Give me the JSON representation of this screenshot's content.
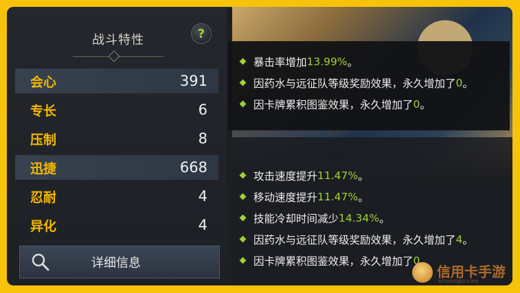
{
  "panel": {
    "title": "战斗特性",
    "help_icon": "?",
    "stats": [
      {
        "name": "会心",
        "value": "391",
        "highlight": true
      },
      {
        "name": "专长",
        "value": "6",
        "highlight": false
      },
      {
        "name": "压制",
        "value": "8",
        "highlight": false
      },
      {
        "name": "迅捷",
        "value": "668",
        "highlight": true
      },
      {
        "name": "忍耐",
        "value": "4",
        "highlight": false
      },
      {
        "name": "异化",
        "value": "4",
        "highlight": false
      }
    ],
    "detail_button": "详细信息"
  },
  "tooltip1": {
    "lines": [
      {
        "text": "暴击率增加",
        "value": "13.99%",
        "suffix": "。"
      },
      {
        "text": "因药水与远征队等级奖励效果，永久增加了",
        "value": "0",
        "suffix": "。"
      },
      {
        "text": "因卡牌累积图鉴效果，永久增加了",
        "value": "0",
        "suffix": "。"
      }
    ]
  },
  "tooltip2": {
    "lines": [
      {
        "text": "攻击速度提升",
        "value": "11.47%",
        "suffix": "。"
      },
      {
        "text": "移动速度提升",
        "value": "11.47%",
        "suffix": "。"
      },
      {
        "text": "技能冷却时间减少",
        "value": "14.34%",
        "suffix": "。"
      },
      {
        "text": "因药水与远征队等级奖励效果，永久增加了",
        "value": "4",
        "suffix": "。"
      },
      {
        "text": "因卡牌累积图鉴效果，永久增加了",
        "value": "0",
        "suffix": "。"
      }
    ]
  },
  "watermark": {
    "main": "信用卡手游",
    "sub": "xinyongju.com"
  },
  "colors": {
    "frame": "#f6c20a",
    "stat_name": "#f5b800",
    "value_green": "#9fd234"
  }
}
